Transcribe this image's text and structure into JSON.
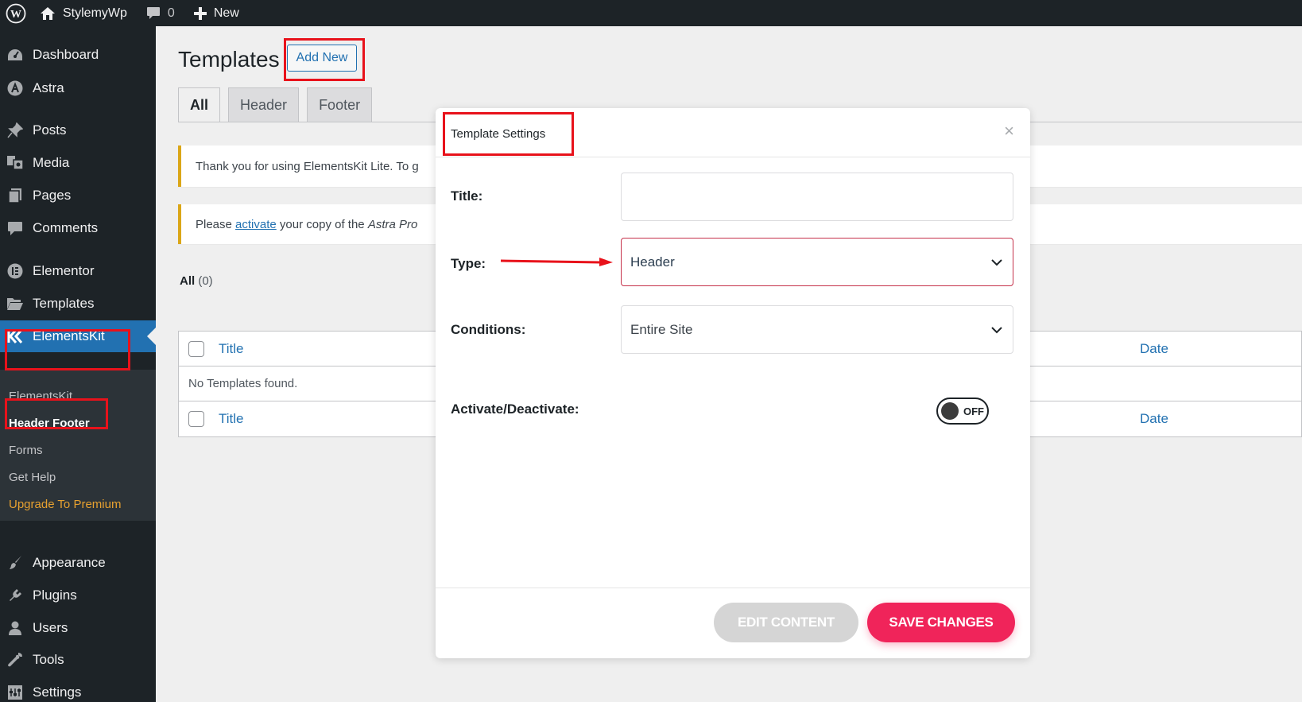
{
  "adminbar": {
    "site_name": "StylemyWp",
    "comments_count": "0",
    "new_label": "New"
  },
  "sidebar": {
    "items": [
      {
        "label": "Dashboard",
        "icon": "dashboard-icon"
      },
      {
        "label": "Astra",
        "icon": "astra-icon"
      },
      {
        "label": "Posts",
        "icon": "pin-icon"
      },
      {
        "label": "Media",
        "icon": "media-icon"
      },
      {
        "label": "Pages",
        "icon": "pages-icon"
      },
      {
        "label": "Comments",
        "icon": "comment-icon"
      },
      {
        "label": "Elementor",
        "icon": "elementor-icon"
      },
      {
        "label": "Templates",
        "icon": "folder-icon"
      },
      {
        "label": "ElementsKit",
        "icon": "elementskit-icon"
      },
      {
        "label": "Appearance",
        "icon": "brush-icon"
      },
      {
        "label": "Plugins",
        "icon": "plug-icon"
      },
      {
        "label": "Users",
        "icon": "user-icon"
      },
      {
        "label": "Tools",
        "icon": "wrench-icon"
      },
      {
        "label": "Settings",
        "icon": "settings-icon"
      }
    ],
    "submenu": [
      "ElementsKit",
      "Header Footer",
      "Forms",
      "Get Help",
      "Upgrade To Premium"
    ]
  },
  "page": {
    "title": "Templates",
    "add_new": "Add New",
    "tabs": [
      "All",
      "Header",
      "Footer"
    ],
    "notice1": "Thank you for using ElementsKit Lite. To g",
    "notice2_prefix": "Please ",
    "notice2_link": "activate",
    "notice2_middle": " your copy of the ",
    "notice2_italic": "Astra Pro",
    "count_label": "All",
    "count_value": "(0)",
    "table": {
      "col_title": "Title",
      "col_date": "Date",
      "empty": "No Templates found."
    }
  },
  "modal": {
    "title": "Template Settings",
    "close": "×",
    "title_label": "Title:",
    "title_value": "",
    "type_label": "Type:",
    "type_value": "Header",
    "conditions_label": "Conditions:",
    "conditions_value": "Entire Site",
    "activate_label": "Activate/Deactivate:",
    "toggle_state": "OFF",
    "edit_button": "EDIT CONTENT",
    "save_button": "SAVE CHANGES"
  },
  "colors": {
    "admin_bg": "#1d2327",
    "highlight": "#2271b1",
    "annotation_red": "#e8121b",
    "save_button": "#f0245a",
    "edit_button": "#d5d5d5"
  }
}
